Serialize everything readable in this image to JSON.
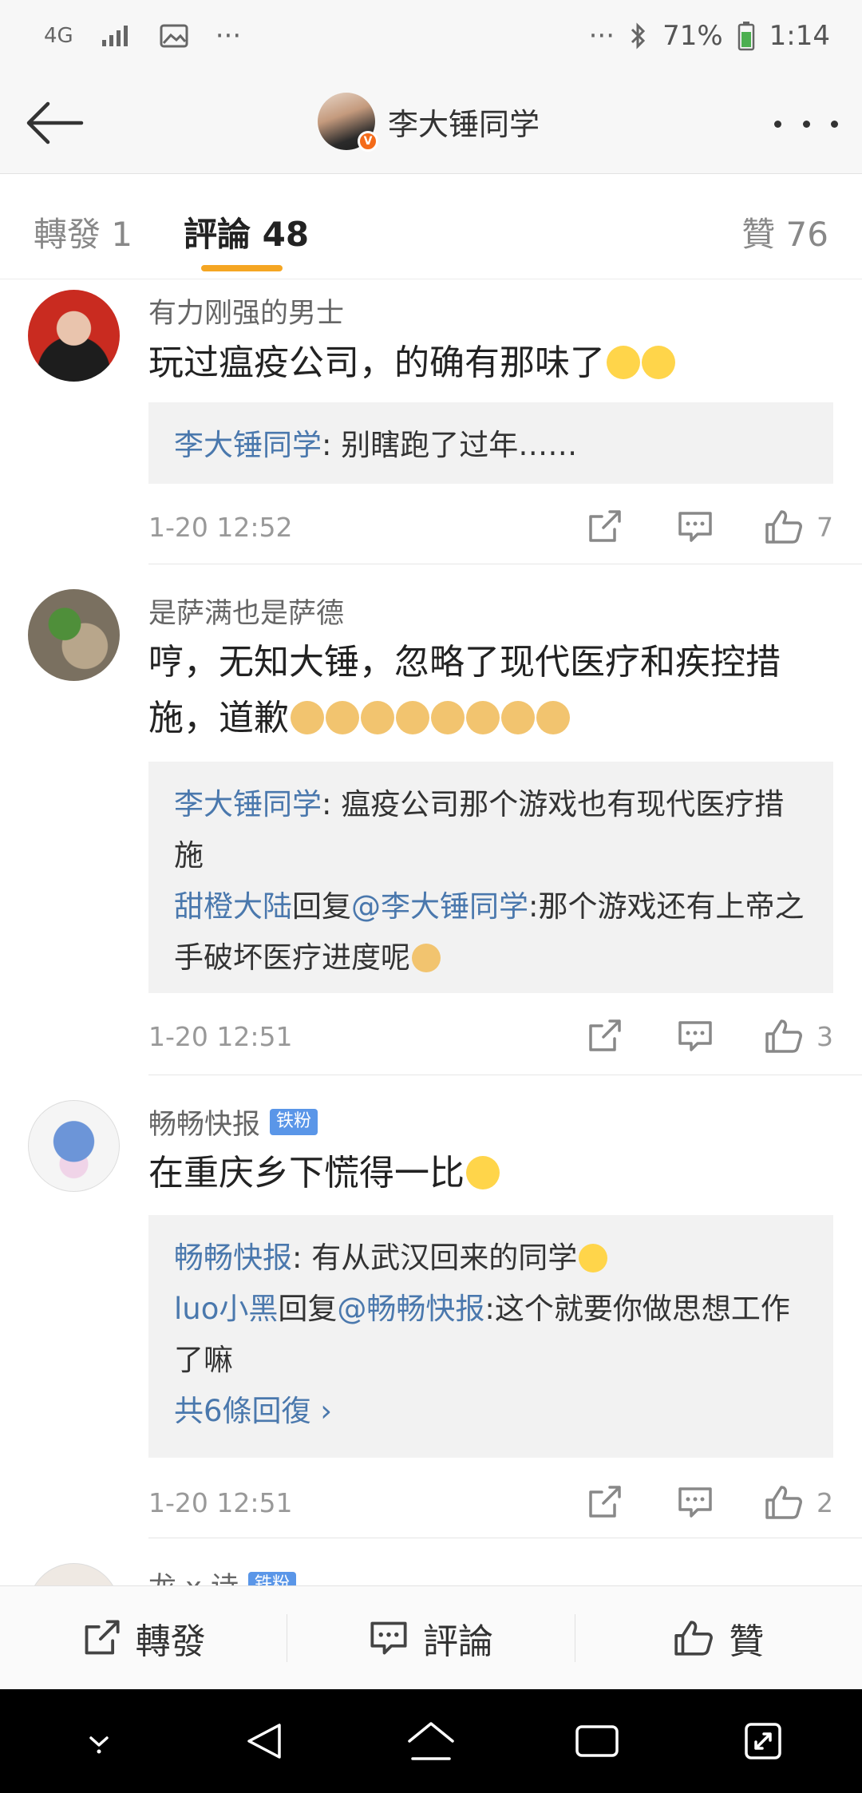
{
  "status_bar": {
    "network": "4G",
    "dots_left": "···",
    "dots_right": "···",
    "battery": "71%",
    "time": "1:14"
  },
  "header": {
    "title": "李大锤同学",
    "verified_badge": "V"
  },
  "tabs": [
    {
      "label": "轉發 1"
    },
    {
      "label": "評論 48"
    },
    {
      "label": "贊 76"
    }
  ],
  "comments": [
    {
      "username": "有力刚强的男士",
      "text": "玩过瘟疫公司，的确有那味了",
      "reply": {
        "author": "李大锤同学",
        "sep": ": ",
        "text": "别瞎跑了过年……"
      },
      "time": "1-20 12:52",
      "likes": "7"
    },
    {
      "username": "是萨满也是萨德",
      "text": "哼，无知大锤，忽略了现代医疗和疾控措施，道歉",
      "reply": {
        "author": "李大锤同学",
        "sep": ": ",
        "text": "瘟疫公司那个游戏也有现代医疗措施",
        "nested_author": "甜橙大陆",
        "nested_word": "回复",
        "nested_mention": "@李大锤同学",
        "nested_text": ":那个游戏还有上帝之手破坏医疗进度呢"
      },
      "time": "1-20 12:51",
      "likes": "3"
    },
    {
      "username": "畅畅快报",
      "badge": "铁粉",
      "text": "在重庆乡下慌得一比",
      "reply": {
        "author": "畅畅快报",
        "sep": ": ",
        "text": "有从武汉回来的同学",
        "nested_author": "luo小黑",
        "nested_word": "回复",
        "nested_mention": "@畅畅快报",
        "nested_text": ":这个就要你做思想工作了嘛",
        "more": "共6條回復 ›"
      },
      "time": "1-20 12:51",
      "likes": "2"
    },
    {
      "username": "龙 ⅹ 诗",
      "badge": "铁粉"
    }
  ],
  "bottom_bar": {
    "repost": "轉發",
    "comment": "評論",
    "like": "贊"
  }
}
